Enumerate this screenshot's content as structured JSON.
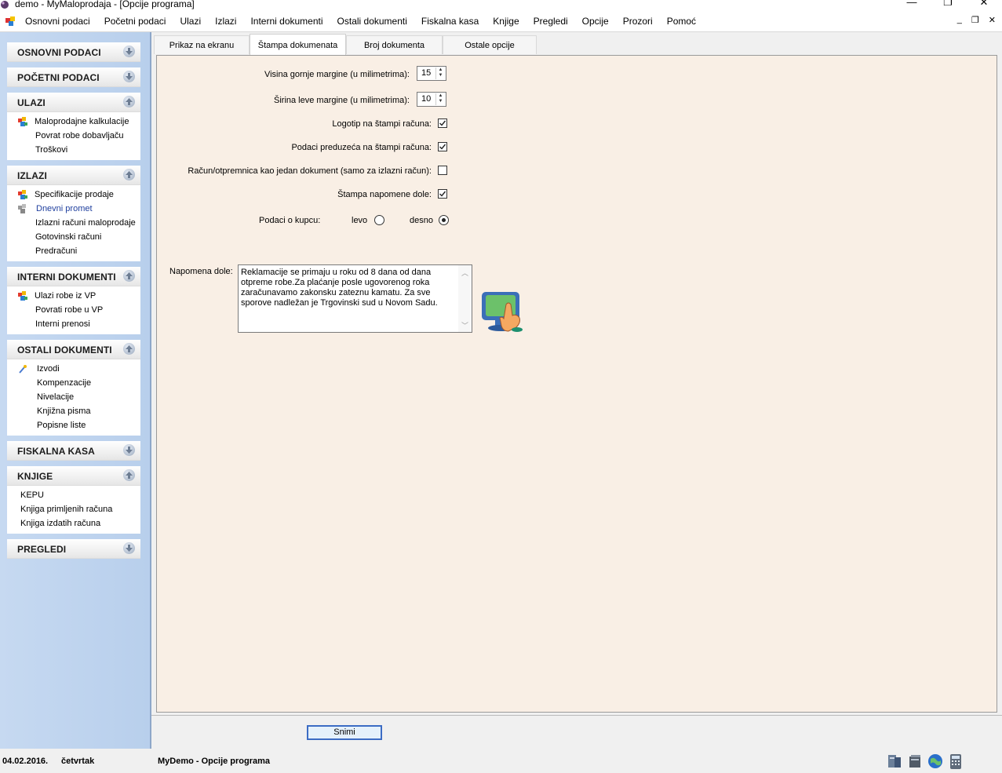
{
  "window": {
    "title": "demo - MyMaloprodaja - [Opcije programa]",
    "minimize_glyph": "—",
    "restore_glyph": "❐",
    "close_glyph": "✕",
    "mdi_min_glyph": "_",
    "mdi_restore_glyph": "❐",
    "mdi_close_glyph": "✕"
  },
  "menu": [
    "Osnovni podaci",
    "Početni podaci",
    "Ulazi",
    "Izlazi",
    "Interni dokumenti",
    "Ostali dokumenti",
    "Fiskalna kasa",
    "Knjige",
    "Pregledi",
    "Opcije",
    "Prozori",
    "Pomoć"
  ],
  "sidebar": {
    "groups": [
      {
        "label": "OSNOVNI PODACI",
        "state": "collapsed",
        "items": []
      },
      {
        "label": "POČETNI PODACI",
        "state": "collapsed",
        "items": []
      },
      {
        "label": "ULAZI",
        "state": "expanded",
        "items": [
          "Maloprodajne kalkulacije",
          "Povrat robe dobavljaču",
          "Troškovi"
        ]
      },
      {
        "label": "IZLAZI",
        "state": "expanded",
        "items": [
          "Specifikacije prodaje",
          "Dnevni promet",
          "Izlazni računi maloprodaje",
          "Gotovinski računi",
          "Predračuni"
        ]
      },
      {
        "label": "INTERNI DOKUMENTI",
        "state": "expanded",
        "items": [
          "Ulazi robe iz VP",
          "Povrati robe u VP",
          "Interni prenosi"
        ]
      },
      {
        "label": "OSTALI DOKUMENTI",
        "state": "expanded",
        "items": [
          "Izvodi",
          "Kompenzacije",
          "Nivelacije",
          "Knjižna pisma",
          "Popisne liste"
        ]
      },
      {
        "label": "FISKALNA KASA",
        "state": "collapsed",
        "items": []
      },
      {
        "label": "KNJIGE",
        "state": "expanded",
        "items": [
          "KEPU",
          "Knjiga primljenih računa",
          "Knjiga izdatih računa"
        ]
      },
      {
        "label": "PREGLEDI",
        "state": "collapsed",
        "items": []
      }
    ]
  },
  "tabs": [
    {
      "label": "Prikaz na ekranu",
      "active": false
    },
    {
      "label": "Štampa dokumenata",
      "active": true
    },
    {
      "label": "Broj dokumenta",
      "active": false
    },
    {
      "label": "Ostale opcije",
      "active": false
    }
  ],
  "form": {
    "top_margin_label": "Visina gornje margine (u milimetrima):",
    "top_margin_value": "15",
    "left_margin_label": "Širina leve margine (u milimetrima):",
    "left_margin_value": "10",
    "logo_label": "Logotip na štampi računa:",
    "logo_checked": true,
    "company_label": "Podaci preduzeća na štampi računa:",
    "company_checked": true,
    "single_doc_label": "Račun/otpremnica kao jedan dokument (samo za izlazni račun):",
    "single_doc_checked": false,
    "note_print_label": "Štampa napomene dole:",
    "note_print_checked": true,
    "buyer_label": "Podaci o kupcu:",
    "buyer_left_label": "levo",
    "buyer_right_label": "desno",
    "buyer_selected": "desno",
    "note_label": "Napomena dole:",
    "note_text": "Reklamacije se primaju u roku od 8 dana od dana otpreme robe.Za plaćanje posle ugovorenog roka zaračunavamo zakonsku zateznu kamatu. Za sve sporove nadležan je Trgovinski sud u Novom Sadu."
  },
  "save_label": "Snimi",
  "status": {
    "date": "04.02.2016.",
    "day": "četvrtak",
    "context": "MyDemo - Opcije programa"
  },
  "colors": {
    "panel_bg": "#f9efe5",
    "sidebar_bg": "#c6d9f1",
    "accent": "#3c6cc4"
  }
}
